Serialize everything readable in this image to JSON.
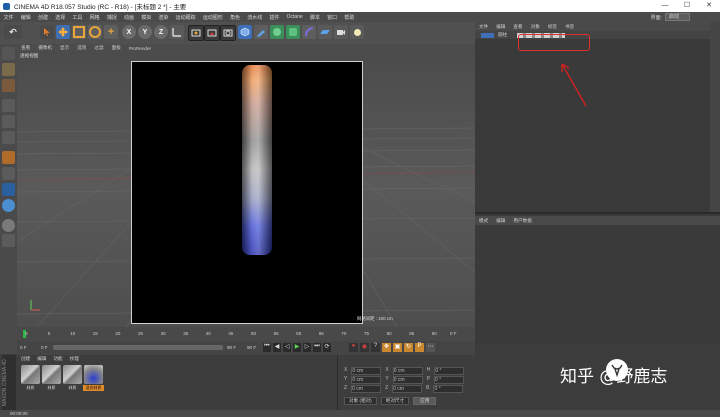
{
  "window": {
    "title": "CINEMA 4D R18.057 Studio (RC - R18) - [未标题 2 *] - 主要",
    "min_icon": "minimize-icon",
    "max_icon": "maximize-icon",
    "close_icon": "close-icon",
    "min": "—",
    "max": "☐",
    "close": "✕"
  },
  "menubar": {
    "items": [
      "文件",
      "编辑",
      "创建",
      "选择",
      "工具",
      "网格",
      "捕捉",
      "动画",
      "模拟",
      "渲染",
      "运动跟踪",
      "运动图形",
      "角色",
      "流水线",
      "插件",
      "Octane",
      "脚本",
      "窗口",
      "帮助"
    ],
    "layout_label": "界面:",
    "layout_value": "启动"
  },
  "toolbar": {
    "axis_x": "X",
    "axis_y": "Y",
    "axis_z": "Z"
  },
  "viewport": {
    "menu": [
      "查看",
      "摄像机",
      "显示",
      "选项",
      "过滤",
      "面板",
      "ProRender"
    ],
    "name": "透视视图",
    "grid_info": "网格间距 : 100 cm"
  },
  "object_manager": {
    "tabs": [
      "文件",
      "编辑",
      "查看",
      "对象",
      "标签",
      "书签"
    ],
    "root_object": "圆柱"
  },
  "attribute_manager": {
    "tabs": [
      "模式",
      "编辑",
      "用户数据"
    ]
  },
  "timeline": {
    "ticks": [
      "0",
      "5",
      "10",
      "15",
      "20",
      "25",
      "30",
      "35",
      "40",
      "45",
      "50",
      "55",
      "60",
      "65",
      "70",
      "75",
      "80",
      "85",
      "90"
    ],
    "end_label": "0 F"
  },
  "transport": {
    "start": "0 F",
    "current": "0 F",
    "end": "90 F",
    "end2": "90 F"
  },
  "materials": {
    "tabs": [
      "创建",
      "编辑",
      "功能",
      "纹理"
    ],
    "items": [
      "材质",
      "材质",
      "材质",
      "混合材质"
    ]
  },
  "coordinates": {
    "rows": [
      {
        "a": "X",
        "a_val": "0 cm",
        "b": "X",
        "b_val": "0 cm",
        "c": "H",
        "c_val": "0 °"
      },
      {
        "a": "Y",
        "a_val": "0 cm",
        "b": "Y",
        "b_val": "0 cm",
        "c": "P",
        "c_val": "0 °"
      },
      {
        "a": "Z",
        "a_val": "0 cm",
        "b": "Z",
        "b_val": "0 cm",
        "c": "B",
        "c_val": "0 °"
      }
    ],
    "mode": "对象 (相对)",
    "size_mode": "绝对尺寸",
    "apply": "应用"
  },
  "statusbar": {
    "time": "00:00:00"
  },
  "watermark": {
    "text": "知乎 @野鹿志"
  }
}
